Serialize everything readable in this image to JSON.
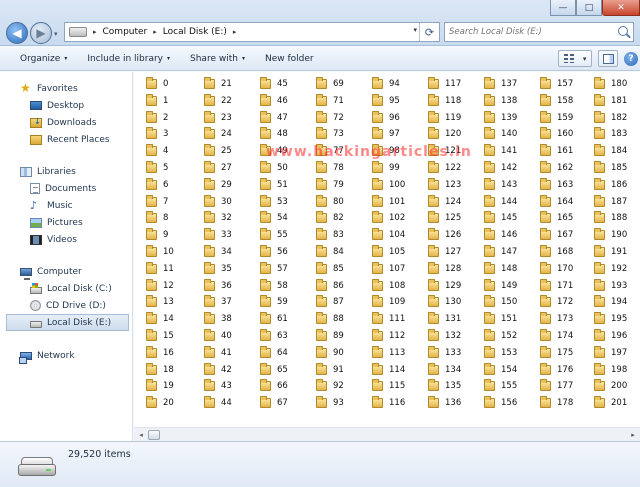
{
  "window": {
    "controls": {
      "minimize": "—",
      "maximize": "□",
      "close": "✕"
    }
  },
  "nav": {
    "back_glyph": "◀",
    "forward_glyph": "▶",
    "dropdown_glyph": "▾"
  },
  "address": {
    "crumbs": [
      "Computer",
      "Local Disk (E:)"
    ],
    "separator": "▸",
    "dropdown_glyph": "▾",
    "refresh_glyph": "⟳"
  },
  "search": {
    "placeholder": "Search Local Disk (E:)"
  },
  "toolbar": {
    "organize": "Organize",
    "include_in_library": "Include in library",
    "share_with": "Share with",
    "new_folder": "New folder",
    "dropdown_glyph": "▾",
    "view_dropdown_glyph": "▾",
    "help_glyph": "?"
  },
  "sidebar": {
    "favorites": {
      "label": "Favorites",
      "items": [
        "Desktop",
        "Downloads",
        "Recent Places"
      ]
    },
    "libraries": {
      "label": "Libraries",
      "items": [
        "Documents",
        "Music",
        "Pictures",
        "Videos"
      ]
    },
    "computer": {
      "label": "Computer",
      "items": [
        "Local Disk (C:)",
        "CD Drive (D:)",
        "Local Disk (E:)"
      ],
      "selected": "Local Disk (E:)"
    },
    "network": {
      "label": "Network"
    }
  },
  "folders": {
    "columns": [
      [
        "0",
        "1",
        "2",
        "3",
        "4",
        "5",
        "6",
        "7",
        "8",
        "9",
        "10",
        "11",
        "12",
        "13",
        "14",
        "15",
        "16",
        "18",
        "19",
        "20"
      ],
      [
        "21",
        "22",
        "23",
        "24",
        "25",
        "27",
        "29",
        "30",
        "32",
        "33",
        "34",
        "35",
        "36",
        "37",
        "38",
        "40",
        "41",
        "42",
        "43",
        "44"
      ],
      [
        "45",
        "46",
        "47",
        "48",
        "49",
        "50",
        "51",
        "53",
        "54",
        "55",
        "56",
        "57",
        "58",
        "59",
        "61",
        "63",
        "64",
        "65",
        "66",
        "67"
      ],
      [
        "69",
        "71",
        "72",
        "73",
        "77",
        "78",
        "79",
        "80",
        "82",
        "83",
        "84",
        "85",
        "86",
        "87",
        "88",
        "89",
        "90",
        "91",
        "92",
        "93"
      ],
      [
        "94",
        "95",
        "96",
        "97",
        "98",
        "99",
        "100",
        "101",
        "102",
        "104",
        "105",
        "107",
        "108",
        "109",
        "111",
        "112",
        "113",
        "114",
        "115",
        "116"
      ],
      [
        "117",
        "118",
        "119",
        "120",
        "121",
        "122",
        "123",
        "124",
        "125",
        "126",
        "127",
        "128",
        "129",
        "130",
        "131",
        "132",
        "133",
        "134",
        "135",
        "136"
      ],
      [
        "137",
        "138",
        "139",
        "140",
        "141",
        "142",
        "143",
        "144",
        "145",
        "146",
        "147",
        "148",
        "149",
        "150",
        "151",
        "152",
        "153",
        "154",
        "155",
        "156"
      ],
      [
        "157",
        "158",
        "159",
        "160",
        "161",
        "162",
        "163",
        "164",
        "165",
        "167",
        "168",
        "170",
        "171",
        "172",
        "173",
        "174",
        "175",
        "176",
        "177",
        "178"
      ],
      [
        "180",
        "181",
        "182",
        "183",
        "184",
        "185",
        "186",
        "187",
        "188",
        "190",
        "191",
        "192",
        "193",
        "194",
        "195",
        "196",
        "197",
        "198",
        "200",
        "201"
      ]
    ]
  },
  "hscroll": {
    "left_glyph": "◂",
    "right_glyph": "▸"
  },
  "watermark": "www.hackingarticles.in",
  "details": {
    "item_count": "29,520 items"
  }
}
